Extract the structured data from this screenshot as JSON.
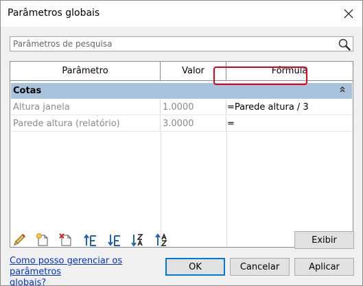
{
  "window": {
    "title": "Parâmetros globais"
  },
  "search": {
    "placeholder": "Parâmetros de pesquisa",
    "value": ""
  },
  "table": {
    "columns": [
      "Parâmetro",
      "Valor",
      "Fórmula"
    ],
    "group": {
      "label": "Cotas"
    },
    "rows": [
      {
        "name": "Altura janela",
        "value": "1.0000",
        "formula": "=Parede altura / 3"
      },
      {
        "name": "Parede altura (relatório)",
        "value": "3.0000",
        "formula": "="
      }
    ]
  },
  "toolbar": {
    "icons": [
      "edit-pencil-icon",
      "new-parameter-icon",
      "delete-parameter-icon",
      "move-up-icon",
      "move-down-icon",
      "sort-ascending-icon",
      "sort-descending-icon"
    ]
  },
  "buttons": {
    "show_label": "Exibir",
    "ok_label": "OK",
    "cancel_label": "Cancelar",
    "apply_label": "Aplicar"
  },
  "help_link": {
    "line1": "Como posso gerenciar os parâmetros",
    "line2": "globais?"
  },
  "colors": {
    "group_header": "#a9c2de",
    "highlight": "#e0001b",
    "link": "#0033cc",
    "primary_border": "#0078d7"
  }
}
